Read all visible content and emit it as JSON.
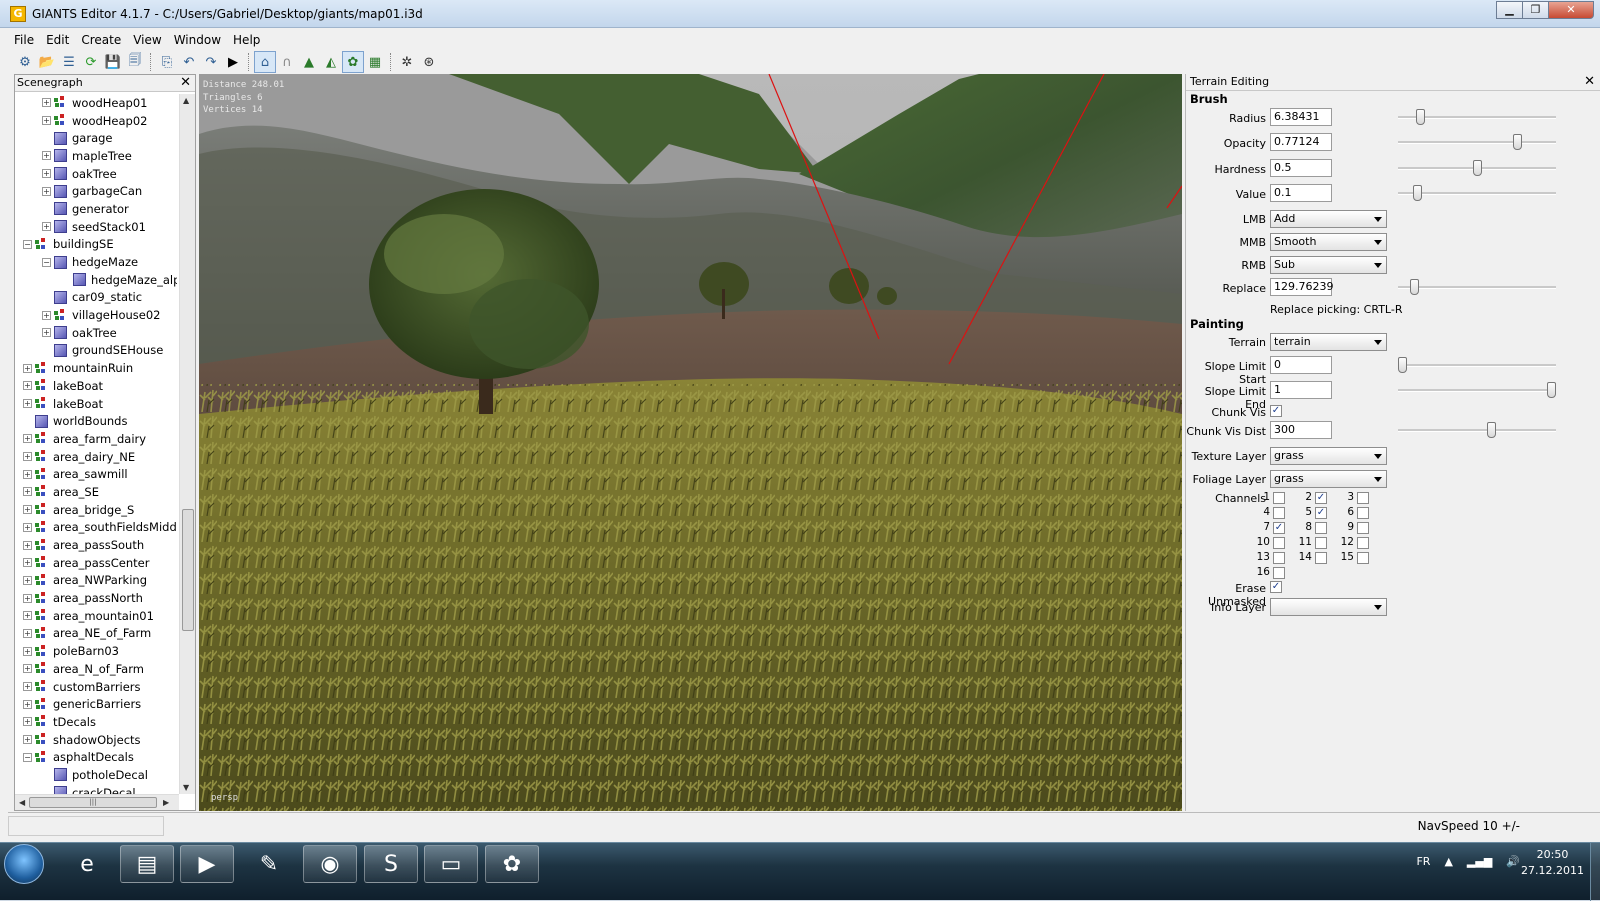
{
  "window": {
    "title": "GIANTS Editor 4.1.7 - C:/Users/Gabriel/Desktop/giants/map01.i3d",
    "icon": "giants-app-icon"
  },
  "menu": [
    "File",
    "Edit",
    "Create",
    "View",
    "Window",
    "Help"
  ],
  "toolbar": {
    "icons": [
      "settings-icon",
      "open-icon",
      "list-icon",
      "refresh-icon",
      "save-icon",
      "save-all-icon",
      "export-icon",
      "undo-icon",
      "redo-icon",
      "play-icon",
      "terrain-select-icon",
      "magnet-icon",
      "terrain-raise-icon",
      "terrain-smooth-icon",
      "foliage-paint-icon",
      "texture-paint-icon",
      "render-settings-icon",
      "camera-settings-icon"
    ]
  },
  "scenegraph": {
    "title": "Scenegraph",
    "items": [
      {
        "label": "woodHeap01",
        "depth": 1,
        "expand": "+",
        "icon": "group"
      },
      {
        "label": "woodHeap02",
        "depth": 1,
        "expand": "+",
        "icon": "group"
      },
      {
        "label": "garage",
        "depth": 1,
        "expand": "",
        "icon": "cube"
      },
      {
        "label": "mapleTree",
        "depth": 1,
        "expand": "+",
        "icon": "cube"
      },
      {
        "label": "oakTree",
        "depth": 1,
        "expand": "+",
        "icon": "cube"
      },
      {
        "label": "garbageCan",
        "depth": 1,
        "expand": "+",
        "icon": "cube"
      },
      {
        "label": "generator",
        "depth": 1,
        "expand": "",
        "icon": "cube"
      },
      {
        "label": "seedStack01",
        "depth": 1,
        "expand": "+",
        "icon": "cube"
      },
      {
        "label": "buildingSE",
        "depth": 0,
        "expand": "-",
        "icon": "group"
      },
      {
        "label": "hedgeMaze",
        "depth": 1,
        "expand": "-",
        "icon": "cube"
      },
      {
        "label": "hedgeMaze_alpha",
        "depth": 2,
        "expand": "",
        "icon": "cube"
      },
      {
        "label": "car09_static",
        "depth": 1,
        "expand": "",
        "icon": "cube"
      },
      {
        "label": "villageHouse02",
        "depth": 1,
        "expand": "+",
        "icon": "group"
      },
      {
        "label": "oakTree",
        "depth": 1,
        "expand": "+",
        "icon": "cube"
      },
      {
        "label": "groundSEHouse",
        "depth": 1,
        "expand": "",
        "icon": "cube"
      },
      {
        "label": "mountainRuin",
        "depth": 0,
        "expand": "+",
        "icon": "group"
      },
      {
        "label": "lakeBoat",
        "depth": 0,
        "expand": "+",
        "icon": "group"
      },
      {
        "label": "lakeBoat",
        "depth": 0,
        "expand": "+",
        "icon": "group"
      },
      {
        "label": "worldBounds",
        "depth": 0,
        "expand": "",
        "icon": "cube"
      },
      {
        "label": "area_farm_dairy",
        "depth": 0,
        "expand": "+",
        "icon": "group"
      },
      {
        "label": "area_dairy_NE",
        "depth": 0,
        "expand": "+",
        "icon": "group"
      },
      {
        "label": "area_sawmill",
        "depth": 0,
        "expand": "+",
        "icon": "group"
      },
      {
        "label": "area_SE",
        "depth": 0,
        "expand": "+",
        "icon": "group"
      },
      {
        "label": "area_bridge_S",
        "depth": 0,
        "expand": "+",
        "icon": "group"
      },
      {
        "label": "area_southFieldsMiddle",
        "depth": 0,
        "expand": "+",
        "icon": "group"
      },
      {
        "label": "area_passSouth",
        "depth": 0,
        "expand": "+",
        "icon": "group"
      },
      {
        "label": "area_passCenter",
        "depth": 0,
        "expand": "+",
        "icon": "group"
      },
      {
        "label": "area_NWParking",
        "depth": 0,
        "expand": "+",
        "icon": "group"
      },
      {
        "label": "area_passNorth",
        "depth": 0,
        "expand": "+",
        "icon": "group"
      },
      {
        "label": "area_mountain01",
        "depth": 0,
        "expand": "+",
        "icon": "group"
      },
      {
        "label": "area_NE_of_Farm",
        "depth": 0,
        "expand": "+",
        "icon": "group"
      },
      {
        "label": "poleBarn03",
        "depth": 0,
        "expand": "+",
        "icon": "group"
      },
      {
        "label": "area_N_of_Farm",
        "depth": 0,
        "expand": "+",
        "icon": "group"
      },
      {
        "label": "customBarriers",
        "depth": 0,
        "expand": "+",
        "icon": "group"
      },
      {
        "label": "genericBarriers",
        "depth": 0,
        "expand": "+",
        "icon": "group"
      },
      {
        "label": "tDecals",
        "depth": 0,
        "expand": "+",
        "icon": "group"
      },
      {
        "label": "shadowObjects",
        "depth": 0,
        "expand": "+",
        "icon": "group"
      },
      {
        "label": "asphaltDecals",
        "depth": 0,
        "expand": "-",
        "icon": "group"
      },
      {
        "label": "potholeDecal",
        "depth": 1,
        "expand": "",
        "icon": "cube"
      },
      {
        "label": "crackDecal",
        "depth": 1,
        "expand": "",
        "icon": "cube"
      }
    ],
    "hscroll_glyph": "|||"
  },
  "viewport": {
    "distance": "Distance 248.01",
    "triangles": "Triangles 6",
    "vertices": "Vertices 14",
    "camera": "persp"
  },
  "terrain_editing": {
    "title": "Terrain Editing",
    "brush_heading": "Brush",
    "radius": {
      "label": "Radius",
      "value": "6.38431",
      "slider": 0.12
    },
    "opacity": {
      "label": "Opacity",
      "value": "0.77124",
      "slider": 0.77
    },
    "hardness": {
      "label": "Hardness",
      "value": "0.5",
      "slider": 0.5
    },
    "value": {
      "label": "Value",
      "value": "0.1",
      "slider": 0.1
    },
    "lmb": {
      "label": "LMB",
      "value": "Add"
    },
    "mmb": {
      "label": "MMB",
      "value": "Smooth"
    },
    "rmb": {
      "label": "RMB",
      "value": "Sub"
    },
    "replace": {
      "label": "Replace",
      "value": "129.76239",
      "slider": 0.08
    },
    "replace_note": "Replace picking: CRTL-R",
    "painting_heading": "Painting",
    "terrain": {
      "label": "Terrain",
      "value": "terrain"
    },
    "slope_start": {
      "label": "Slope Limit Start",
      "value": "0",
      "slider": 0.0
    },
    "slope_end": {
      "label": "Slope Limit End",
      "value": "1",
      "slider": 1.0
    },
    "chunk_vis": {
      "label": "Chunk Vis",
      "checked": true
    },
    "chunk_vis_dist": {
      "label": "Chunk Vis Dist",
      "value": "300",
      "slider": 0.6
    },
    "texture_layer": {
      "label": "Texture Layer",
      "value": "grass"
    },
    "foliage_layer": {
      "label": "Foliage Layer",
      "value": "grass"
    },
    "channels_label": "Channels",
    "channels": [
      {
        "n": "1",
        "checked": false
      },
      {
        "n": "2",
        "checked": true
      },
      {
        "n": "3",
        "checked": false
      },
      {
        "n": "4",
        "checked": false
      },
      {
        "n": "5",
        "checked": true
      },
      {
        "n": "6",
        "checked": false
      },
      {
        "n": "7",
        "checked": true
      },
      {
        "n": "8",
        "checked": false
      },
      {
        "n": "9",
        "checked": false
      },
      {
        "n": "10",
        "checked": false
      },
      {
        "n": "11",
        "checked": false
      },
      {
        "n": "12",
        "checked": false
      },
      {
        "n": "13",
        "checked": false
      },
      {
        "n": "14",
        "checked": false
      },
      {
        "n": "15",
        "checked": false
      },
      {
        "n": "16",
        "checked": false
      }
    ],
    "erase_unmasked": {
      "label": "Erase Unmasked",
      "checked": true
    },
    "info_layer": {
      "label": "Info Layer",
      "value": ""
    }
  },
  "statusbar": {
    "navspeed": "NavSpeed 10 +/-"
  },
  "taskbar": {
    "apps": [
      {
        "name": "internet-explorer-icon",
        "glyph": "e"
      },
      {
        "name": "file-explorer-icon",
        "glyph": "▤"
      },
      {
        "name": "media-player-icon",
        "glyph": "▶"
      },
      {
        "name": "paint-tool-icon",
        "glyph": "✎"
      },
      {
        "name": "firefox-icon",
        "glyph": "◉"
      },
      {
        "name": "skype-icon",
        "glyph": "S"
      },
      {
        "name": "giants-editor-task-icon",
        "glyph": "▭"
      },
      {
        "name": "paint-icon",
        "glyph": "✿"
      }
    ],
    "lang": "FR",
    "time": "20:50",
    "date": "27.12.2011"
  }
}
